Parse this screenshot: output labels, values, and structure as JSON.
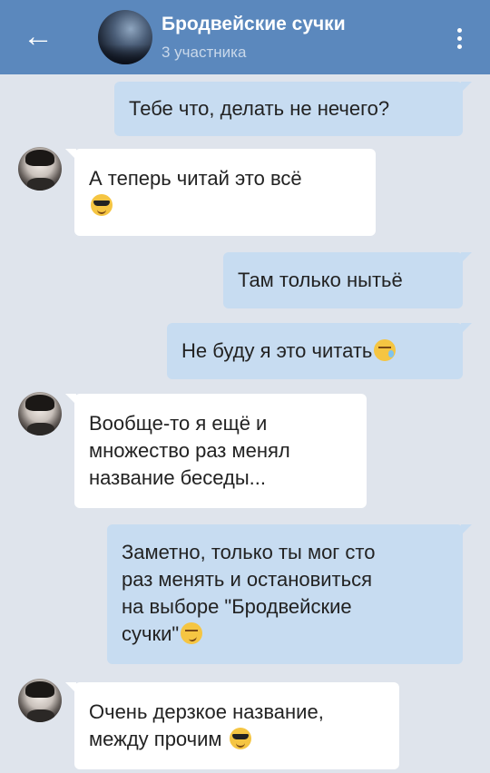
{
  "header": {
    "title": "Бродвейские сучки",
    "subtitle": "3 участника",
    "back_icon": "back-arrow-icon",
    "menu_icon": "more-vertical-icon"
  },
  "colors": {
    "header_bg": "#5b88bd",
    "chat_bg": "#dfe4ec",
    "outgoing_bubble": "#c7dcf1",
    "incoming_bubble": "#ffffff"
  },
  "messages": [
    {
      "direction": "out",
      "lines": [
        "Тебе что, делать не нечего?"
      ]
    },
    {
      "direction": "in",
      "lines": [
        "А теперь читай это всё"
      ],
      "emoji": "smiling-face-with-sunglasses"
    },
    {
      "direction": "out",
      "lines": [
        "Там только нытьё"
      ]
    },
    {
      "direction": "out",
      "lines": [
        "Не буду я это читать"
      ],
      "emoji": "sleepy-face"
    },
    {
      "direction": "in",
      "lines": [
        "Вообще-то я ещё и",
        "множество раз менял",
        "название беседы..."
      ]
    },
    {
      "direction": "out",
      "lines": [
        "Заметно, только ты мог сто",
        "раз менять и остановиться",
        "на выборе \"Бродвейские",
        "сучки\""
      ],
      "emoji": "smirking-face"
    },
    {
      "direction": "in",
      "lines": [
        "Очень дерзкое название,",
        "между прочим"
      ],
      "emoji": "smiling-face-with-sunglasses"
    }
  ]
}
